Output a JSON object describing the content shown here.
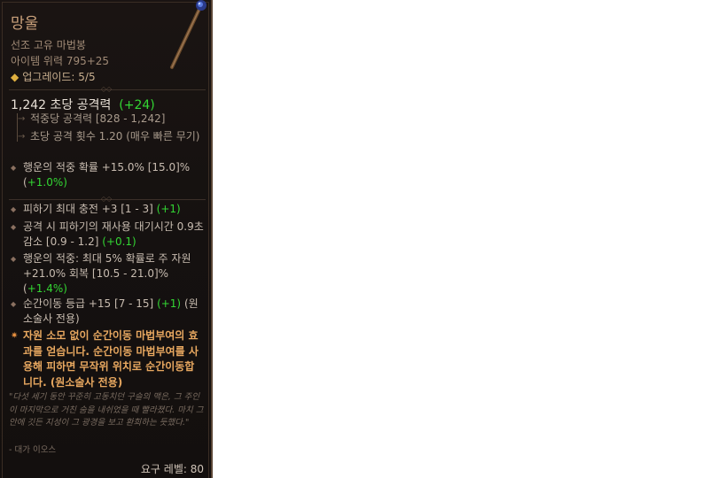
{
  "item": {
    "name": "망울",
    "type": "선조 고유 마법봉",
    "power": "아이템 위력 795+25",
    "upgrades": "업그레이드: 5/5"
  },
  "dps": {
    "value": "1,242 초당 공격력",
    "bonus": "(+24)"
  },
  "weapon_stats": [
    "적중당 공격력 [828 - 1,242]",
    "초당 공격 횟수 1.20 (매우 빠른 무기)"
  ],
  "implicit": {
    "text": "행운의 적중 확률 +15.0% [15.0]% (",
    "bonus": "+1.0%)"
  },
  "affixes": [
    {
      "text": "피하기 최대 충전 +3 [1 - 3] ",
      "bonus": "(+1)",
      "tail": ""
    },
    {
      "text": "공격 시 피하기의 재사용 대기시간 0.9초 감소 [0.9 - 1.2] ",
      "bonus": "(+0.1)",
      "tail": ""
    },
    {
      "text": "행운의 적중: 최대 5% 확률로 주 자원 +21.0% 회복 [10.5 - 21.0]% (",
      "bonus": "+1.4%)",
      "tail": ""
    },
    {
      "text": "순간이동 등급 +15 [7 - 15] ",
      "bonus": "(+1)",
      "tail": " (원소술사 전용)"
    }
  ],
  "unique_power": "자원 소모 없이 순간이동 마법부여의 효과를 얻습니다. 순간이동 마법부여를 사용해 피하면 무작위 위치로 순간이동합니다. (원소술사 전용)",
  "flavor": "\"다섯 세기 동안 꾸준히 고동치던 구슬의 맥은, 그 주인이 마지막으로 거친 숨을 내쉬었을 때 빨라졌다. 마치 그 안에 깃든 지성이 그 광경을 보고 환희하는 듯했다.\"",
  "author": "- 대가 이오스",
  "required_level": "요구 레벨: 80",
  "colors": {
    "name": "#c9a07a",
    "bonus_green": "#33d633",
    "unique_orange": "#e8a860",
    "background": "#151110"
  }
}
